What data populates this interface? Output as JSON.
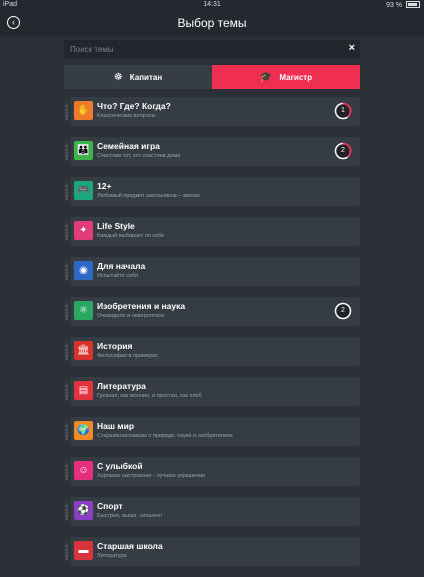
{
  "status_bar": {
    "device": "iPad",
    "time": "14:31",
    "battery": "93 %"
  },
  "header": {
    "title": "Выбор темы"
  },
  "search": {
    "placeholder": "Поиск темы"
  },
  "tabs": [
    {
      "label": "Капитан",
      "icon": "ship-wheel-icon",
      "active": false
    },
    {
      "label": "Магистр",
      "icon": "graduation-cap-icon",
      "active": true
    }
  ],
  "themes": [
    {
      "level": "МАГИСТР",
      "title": "Что? Где? Когда?",
      "subtitle": "Классические вопросы",
      "icon": "owl-icon",
      "glyph": "✋",
      "color": "#f07a2c",
      "badge": "1",
      "progress": 0.4
    },
    {
      "level": "МАГИСТР",
      "title": "Семейная игра",
      "subtitle": "Счастлив тот, кто счастлив дома",
      "icon": "family-icon",
      "glyph": "👪",
      "color": "#3ab54a",
      "badge": "2",
      "progress": 0.4
    },
    {
      "level": "МАГИСТР",
      "title": "12+",
      "subtitle": "Любимый предмет школьников – звонок",
      "icon": "gamepad-icon",
      "glyph": "🎮",
      "color": "#1ba77a",
      "badge": "",
      "progress": 0
    },
    {
      "level": "МАГИСТР",
      "title": "Life Style",
      "subtitle": "Каждый выбирает по себе",
      "icon": "puzzle-icon",
      "glyph": "✦",
      "color": "#e23b7a",
      "badge": "",
      "progress": 0
    },
    {
      "level": "МАГИСТР",
      "title": "Для начала",
      "subtitle": "Испытайте себя",
      "icon": "owl-icon",
      "glyph": "◉",
      "color": "#2d68c4",
      "badge": "",
      "progress": 0
    },
    {
      "level": "МАГИСТР",
      "title": "Изобретения и наука",
      "subtitle": "Очевидное и невероятное",
      "icon": "atom-icon",
      "glyph": "⚛",
      "color": "#2aa862",
      "badge": "2",
      "progress": 0
    },
    {
      "level": "МАГИСТР",
      "title": "История",
      "subtitle": "Философия в примерах",
      "icon": "columns-icon",
      "glyph": "🏛",
      "color": "#d8332a",
      "badge": "",
      "progress": 0
    },
    {
      "level": "МАГИСТР",
      "title": "Литература",
      "subtitle": "Грозная, как молния, и простая, как хлеб",
      "icon": "book-icon",
      "glyph": "▤",
      "color": "#e5323f",
      "badge": "",
      "progress": 0
    },
    {
      "level": "МАГИСТР",
      "title": "Наш мир",
      "subtitle": "Старшеклассникам о природе, науке и изобретениях",
      "icon": "globe-icon",
      "glyph": "🌍",
      "color": "#f08a24",
      "badge": "",
      "progress": 0
    },
    {
      "level": "МАГИСТР",
      "title": "С улыбкой",
      "subtitle": "Хорошее настроение - лучшее украшение",
      "icon": "smile-icon",
      "glyph": "☺",
      "color": "#e5307f",
      "badge": "",
      "progress": 0
    },
    {
      "level": "МАГИСТР",
      "title": "Спорт",
      "subtitle": "Быстрее, выше, сильнее!",
      "icon": "ball-icon",
      "glyph": "⚽",
      "color": "#8a3ec6",
      "badge": "",
      "progress": 0
    },
    {
      "level": "МАГИСТР",
      "title": "Старшая школа",
      "subtitle": "Литература",
      "icon": "book-stack-icon",
      "glyph": "▬",
      "color": "#d9333b",
      "badge": "",
      "progress": 0
    }
  ]
}
